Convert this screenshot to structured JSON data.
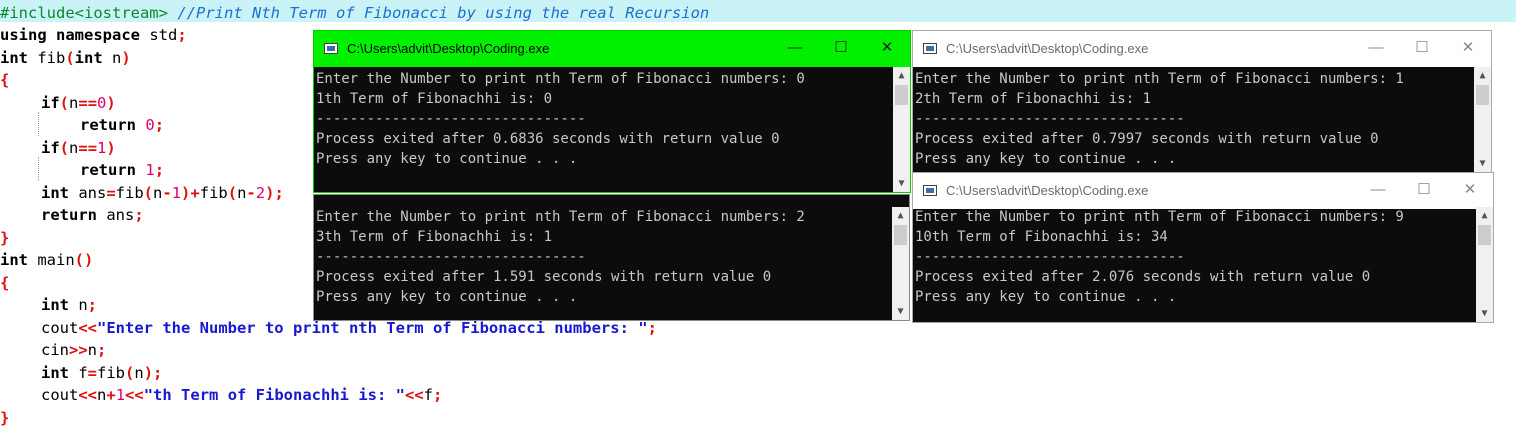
{
  "editor": {
    "lines": {
      "l1": {
        "pp": "#include<iostream>",
        "cm": "//Print Nth Term of Fibonacci by using the real Recursion"
      },
      "l2": {
        "kw1": "using namespace",
        "rest": " std",
        "semi": ";"
      },
      "l3": {
        "kw": "int",
        "name": " fib",
        "p1": "(",
        "kw2": "int",
        "arg": " n",
        "p2": ")"
      },
      "l4": {
        "b": "{"
      },
      "l5": {
        "kw": "if",
        "p1": "(",
        "a": "n",
        "op": "==",
        "num": "0",
        "p2": ")"
      },
      "l6": {
        "kw": "return",
        "num": "0",
        "semi": ";"
      },
      "l7": {
        "kw": "if",
        "p1": "(",
        "a": "n",
        "op": "==",
        "num": "1",
        "p2": ")"
      },
      "l8": {
        "kw": "return",
        "num": "1",
        "semi": ";"
      },
      "l9": {
        "kw": "int",
        "a": " ans",
        "op1": "=",
        "f1": "fib",
        "p1": "(",
        "n1": "n",
        "m1": "-",
        "k1": "1",
        "p2": ")",
        "plus": "+",
        "f2": "fib",
        "p3": "(",
        "n2": "n",
        "m2": "-",
        "k2": "2",
        "p4": ")",
        "semi": ";"
      },
      "l10": {
        "kw": "return",
        "a": " ans",
        "semi": ";"
      },
      "l11": {
        "b": "}"
      },
      "l12": {
        "kw": "int",
        "name": " main",
        "p": "()"
      },
      "l13": {
        "b": "{"
      },
      "l14": {
        "kw": "int",
        "a": " n",
        "semi": ";"
      },
      "l15": {
        "a": "cout",
        "op": "<<",
        "str": "\"Enter the Number to print nth Term of Fibonacci numbers: \"",
        "semi": ";"
      },
      "l16": {
        "a": "cin",
        "op": ">>",
        "b": "n",
        "semi": ";"
      },
      "l17": {
        "kw": "int",
        "a": " f",
        "op": "=",
        "f": "fib",
        "p1": "(",
        "n": "n",
        "p2": ")",
        "semi": ";"
      },
      "l18": {
        "a": "cout",
        "op1": "<<",
        "n": "n",
        "plus": "+",
        "one": "1",
        "op2": "<<",
        "str": "\"th Term of Fibonachhi is: \"",
        "op3": "<<",
        "f": "f",
        "semi": ";"
      },
      "l19": {
        "b": "}"
      }
    }
  },
  "windows": [
    {
      "title": "C:\\Users\\advit\\Desktop\\Coding.exe",
      "active": true,
      "console": "Enter the Number to print nth Term of Fibonacci numbers: 0\n1th Term of Fibonachhi is: 0\n--------------------------------\nProcess exited after 0.6836 seconds with return value 0\nPress any key to continue . . ."
    },
    {
      "title": "C:\\Users\\advit\\Desktop\\Coding.exe",
      "active": false,
      "console": "Enter the Number to print nth Term of Fibonacci numbers: 1\n2th Term of Fibonachhi is: 1\n--------------------------------\nProcess exited after 0.7997 seconds with return value 0\nPress any key to continue . . ."
    },
    {
      "console": "Enter the Number to print nth Term of Fibonacci numbers: 2\n3th Term of Fibonachhi is: 1\n--------------------------------\nProcess exited after 1.591 seconds with return value 0\nPress any key to continue . . ."
    },
    {
      "title": "C:\\Users\\advit\\Desktop\\Coding.exe",
      "active": false,
      "console": "Enter the Number to print nth Term of Fibonacci numbers: 9\n10th Term of Fibonachhi is: 34\n--------------------------------\nProcess exited after 2.076 seconds with return value 0\nPress any key to continue . . ."
    }
  ],
  "controls": {
    "minimize": "—",
    "maximize": "☐",
    "close": "✕",
    "scroll_up": "▲",
    "scroll_down": "▼"
  },
  "colors": {
    "active_titlebar": "#00f000",
    "console_bg": "#0c0c0c",
    "console_text": "#c8c8c8",
    "line_highlight": "#c9f3f7"
  }
}
